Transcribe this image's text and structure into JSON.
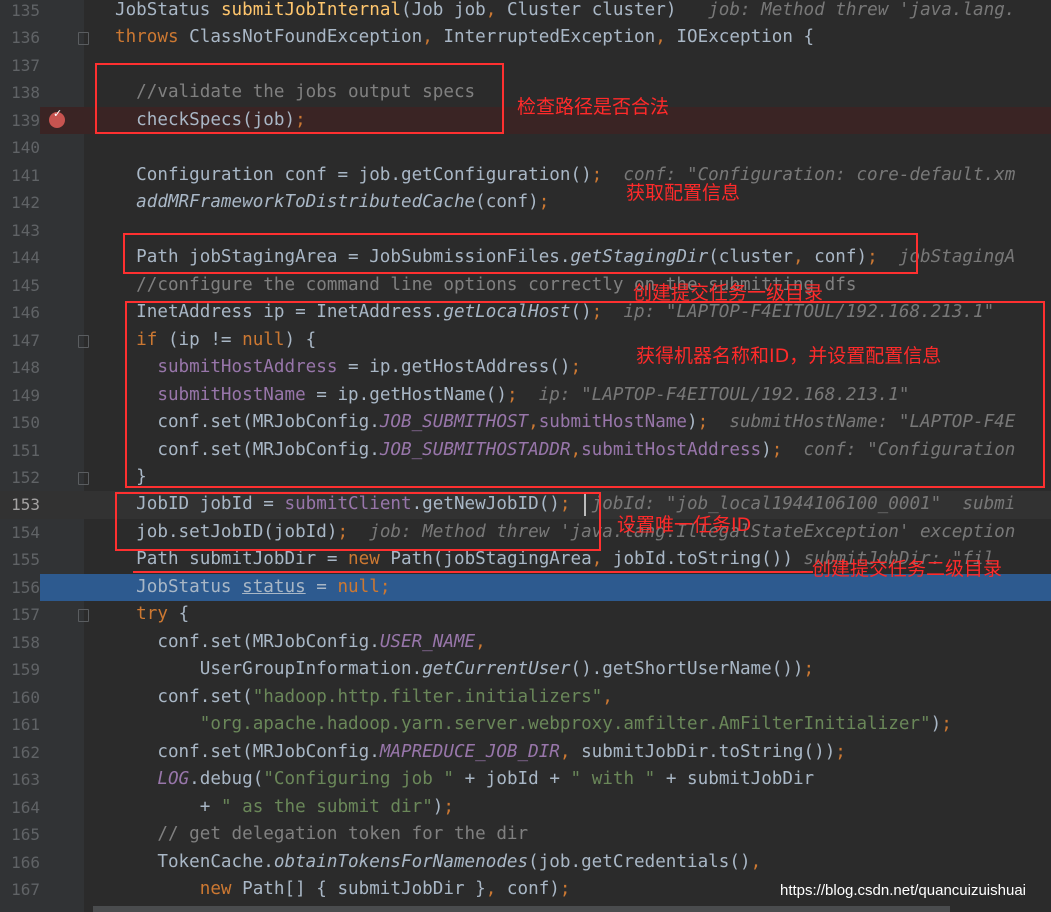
{
  "editor": {
    "colors": {
      "background": "#2b2b2b",
      "keyword": "#cc7832",
      "field": "#9876aa",
      "string": "#6a8759",
      "comment": "#808080",
      "selection": "#2d5a8f",
      "breakpoint_line": "#3a2424",
      "annotation": "#ff2a2a"
    },
    "breakpoint_line": 139,
    "current_line": 153,
    "selected_line": 156,
    "lines": [
      {
        "n": 135,
        "t": [
          [
            "",
            "JobStatus "
          ],
          [
            "md",
            "submitJobInternal"
          ],
          [
            "",
            "(Job job"
          ],
          [
            "pn",
            ","
          ],
          [
            "",
            " Cluster cluster)   "
          ],
          [
            "hint",
            "job: Method threw 'java.lang."
          ]
        ]
      },
      {
        "n": 136,
        "t": [
          [
            "kw",
            "throws "
          ],
          [
            "",
            "ClassNotFoundException"
          ],
          [
            "pn",
            ","
          ],
          [
            "",
            " InterruptedException"
          ],
          [
            "pn",
            ","
          ],
          [
            "",
            " IOException {"
          ]
        ]
      },
      {
        "n": 137,
        "t": []
      },
      {
        "n": 138,
        "t": [
          [
            "cm",
            "  //validate the jobs output specs"
          ]
        ]
      },
      {
        "n": 139,
        "t": [
          [
            "",
            "  checkSpecs(job)"
          ],
          [
            "pn",
            ";"
          ]
        ]
      },
      {
        "n": 140,
        "t": []
      },
      {
        "n": 141,
        "t": [
          [
            "",
            "  Configuration conf = job.getConfiguration()"
          ],
          [
            "pn",
            ";"
          ],
          [
            "hint",
            "  conf: \"Configuration: core-default.xm"
          ]
        ]
      },
      {
        "n": 142,
        "t": [
          [
            "si",
            "  addMRFrameworkToDistributedCache"
          ],
          [
            "",
            "(conf)"
          ],
          [
            "pn",
            ";"
          ]
        ]
      },
      {
        "n": 143,
        "t": []
      },
      {
        "n": 144,
        "t": [
          [
            "",
            "  Path jobStagingArea = JobSubmissionFiles."
          ],
          [
            "si",
            "getStagingDir"
          ],
          [
            "",
            "(cluster"
          ],
          [
            "pn",
            ","
          ],
          [
            "",
            " conf)"
          ],
          [
            "pn",
            ";"
          ],
          [
            "hint",
            "  jobStagingA"
          ]
        ]
      },
      {
        "n": 145,
        "t": [
          [
            "cm",
            "  //configure the command line options correctly on the submitting dfs"
          ]
        ]
      },
      {
        "n": 146,
        "t": [
          [
            "",
            "  InetAddress ip = InetAddress."
          ],
          [
            "si",
            "getLocalHost"
          ],
          [
            "",
            "()"
          ],
          [
            "pn",
            ";"
          ],
          [
            "hint",
            "  ip: \"LAPTOP-F4EITOUL/192.168.213.1\""
          ]
        ]
      },
      {
        "n": 147,
        "t": [
          [
            "kw",
            "  if "
          ],
          [
            "",
            "(ip != "
          ],
          [
            "kw",
            "null"
          ],
          [
            "",
            ") {"
          ]
        ]
      },
      {
        "n": 148,
        "t": [
          [
            "fd",
            "    submitHostAddress"
          ],
          [
            "",
            " = ip.getHostAddress()"
          ],
          [
            "pn",
            ";"
          ]
        ]
      },
      {
        "n": 149,
        "t": [
          [
            "fd",
            "    submitHostName"
          ],
          [
            "",
            " = ip.getHostName()"
          ],
          [
            "pn",
            ";"
          ],
          [
            "hint",
            "  ip: \"LAPTOP-F4EITOUL/192.168.213.1\""
          ]
        ]
      },
      {
        "n": 150,
        "t": [
          [
            "",
            "    conf.set(MRJobConfig."
          ],
          [
            "fdi",
            "JOB_SUBMITHOST"
          ],
          [
            "pn",
            ","
          ],
          [
            "fd",
            "submitHostName"
          ],
          [
            "",
            ")"
          ],
          [
            "pn",
            ";"
          ],
          [
            "hint",
            "  submitHostName: \"LAPTOP-F4E"
          ]
        ]
      },
      {
        "n": 151,
        "t": [
          [
            "",
            "    conf.set(MRJobConfig."
          ],
          [
            "fdi",
            "JOB_SUBMITHOSTADDR"
          ],
          [
            "pn",
            ","
          ],
          [
            "fd",
            "submitHostAddress"
          ],
          [
            "",
            ")"
          ],
          [
            "pn",
            ";"
          ],
          [
            "hint",
            "  conf: \"Configuration"
          ]
        ]
      },
      {
        "n": 152,
        "t": [
          [
            "",
            "  }"
          ]
        ]
      },
      {
        "n": 153,
        "t": [
          [
            "",
            "  JobID jobId = "
          ],
          [
            "fd",
            "submitClient"
          ],
          [
            "",
            ".getNewJobID()"
          ],
          [
            "pn",
            ";"
          ],
          [
            "hint",
            "  jobId: \"job_local1944106100_0001\"  submi"
          ]
        ]
      },
      {
        "n": 154,
        "t": [
          [
            "",
            "  job.setJobID(jobId)"
          ],
          [
            "pn",
            ";"
          ],
          [
            "hint",
            "  job: Method threw 'java.lang.IllegalStateException' exception"
          ]
        ]
      },
      {
        "n": 155,
        "t": [
          [
            "",
            "  Path submitJobDir = "
          ],
          [
            "kw",
            "new "
          ],
          [
            "",
            "Path(jobStagingArea"
          ],
          [
            "pn",
            ","
          ],
          [
            "",
            " jobId.toString())"
          ],
          [
            "hint",
            " submitJobDir: \"fil"
          ]
        ]
      },
      {
        "n": 156,
        "t": [
          [
            "",
            "  JobStatus "
          ],
          [
            "ul",
            "status"
          ],
          [
            "",
            " = "
          ],
          [
            "kw",
            "null;"
          ]
        ]
      },
      {
        "n": 157,
        "t": [
          [
            "kw",
            "  try "
          ],
          [
            "",
            "{"
          ]
        ]
      },
      {
        "n": 158,
        "t": [
          [
            "",
            "    conf.set(MRJobConfig."
          ],
          [
            "fdi",
            "USER_NAME"
          ],
          [
            "pn",
            ","
          ]
        ]
      },
      {
        "n": 159,
        "t": [
          [
            "",
            "        UserGroupInformation."
          ],
          [
            "si",
            "getCurrentUser"
          ],
          [
            "",
            "().getShortUserName())"
          ],
          [
            "pn",
            ";"
          ]
        ]
      },
      {
        "n": 160,
        "t": [
          [
            "",
            "    conf.set("
          ],
          [
            "st",
            "\"hadoop.http.filter.initializers\""
          ],
          [
            "pn",
            ","
          ]
        ]
      },
      {
        "n": 161,
        "t": [
          [
            "st",
            "        \"org.apache.hadoop.yarn.server.webproxy.amfilter.AmFilterInitializer\""
          ],
          [
            "",
            ")"
          ],
          [
            "pn",
            ";"
          ]
        ]
      },
      {
        "n": 162,
        "t": [
          [
            "",
            "    conf.set(MRJobConfig."
          ],
          [
            "fdi",
            "MAPREDUCE_JOB_DIR"
          ],
          [
            "pn",
            ","
          ],
          [
            "",
            " submitJobDir.toString())"
          ],
          [
            "pn",
            ";"
          ]
        ]
      },
      {
        "n": 163,
        "t": [
          [
            "fdi",
            "    LOG"
          ],
          [
            "",
            ".debug("
          ],
          [
            "st",
            "\"Configuring job \""
          ],
          [
            "",
            " + jobId + "
          ],
          [
            "st",
            "\" with \""
          ],
          [
            "",
            " + submitJobDir"
          ]
        ]
      },
      {
        "n": 164,
        "t": [
          [
            "",
            "        + "
          ],
          [
            "st",
            "\" as the submit dir\""
          ],
          [
            "",
            ")"
          ],
          [
            "pn",
            ";"
          ]
        ]
      },
      {
        "n": 165,
        "t": [
          [
            "cm",
            "    // get delegation token for the dir"
          ]
        ]
      },
      {
        "n": 166,
        "t": [
          [
            "",
            "    TokenCache."
          ],
          [
            "si",
            "obtainTokensForNamenodes"
          ],
          [
            "",
            "(job.getCredentials()"
          ],
          [
            "pn",
            ","
          ]
        ]
      },
      {
        "n": 167,
        "t": [
          [
            "kw",
            "        new "
          ],
          [
            "",
            "Path[] { submitJobDir }"
          ],
          [
            "pn",
            ","
          ],
          [
            "",
            " conf)"
          ],
          [
            "pn",
            ";"
          ]
        ]
      }
    ]
  },
  "annotations": {
    "check_specs": "检查路径是否合法",
    "get_config": "获取配置信息",
    "staging_dir": "创建提交任务一级目录",
    "host_info": "获得机器名称和ID，并设置配置信息",
    "job_id": "设置唯一任务ID",
    "submit_dir": "创建提交任务二级目录"
  },
  "watermark": "https://blog.csdn.net/quancuizuishuai"
}
